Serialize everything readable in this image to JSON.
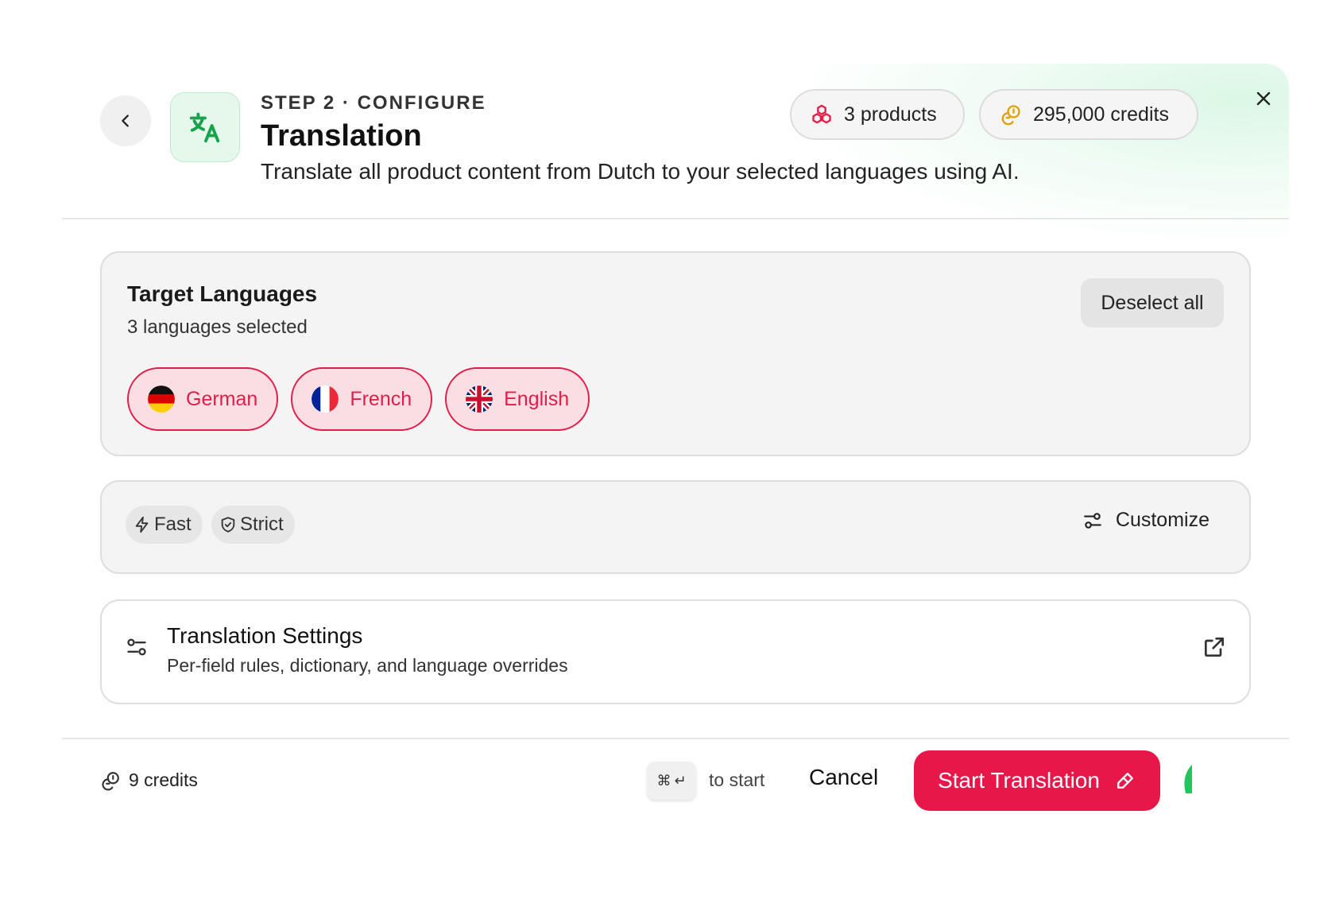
{
  "header": {
    "step_label": "STEP 2 · CONFIGURE",
    "title": "Translation",
    "subtitle": "Translate all product content from Dutch to your selected languages using AI.",
    "products_pill": "3 products",
    "credits_pill": "295,000 credits"
  },
  "languages": {
    "title": "Target Languages",
    "count_text": "3 languages selected",
    "deselect_label": "Deselect all",
    "chips": [
      {
        "label": "German",
        "flag": "de-flag-icon"
      },
      {
        "label": "French",
        "flag": "fr-flag-icon"
      },
      {
        "label": "English",
        "flag": "gb-flag-icon"
      }
    ]
  },
  "modes": {
    "fast_label": "Fast",
    "strict_label": "Strict",
    "customize_label": "Customize"
  },
  "settings": {
    "title": "Translation Settings",
    "description": "Per-field rules, dictionary, and language overrides"
  },
  "footer": {
    "credits": "9 credits",
    "shortcut_hint": "to start",
    "cancel_label": "Cancel",
    "start_label": "Start Translation"
  },
  "colors": {
    "accent": "#e8174a",
    "chip_bg": "#f9dfe4",
    "icon_green": "#16a34a",
    "credits_gold": "#e0a100"
  }
}
